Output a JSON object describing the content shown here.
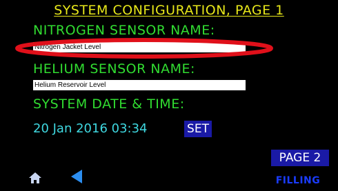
{
  "screen": {
    "title": "SYSTEM CONFIGURATION, PAGE 1",
    "nitrogen": {
      "label": "NITROGEN SENSOR NAME:",
      "value": "Nitrogen Jacket Level"
    },
    "helium": {
      "label": "HELIUM SENSOR NAME:",
      "value": "Helium Reservoir Level"
    },
    "datetime": {
      "label": "SYSTEM DATE & TIME:",
      "value": "20 Jan 2016 03:34",
      "set_label": "SET"
    },
    "page2_label": "PAGE 2",
    "status_text": "FILLING"
  },
  "icons": {
    "home": "home-icon",
    "back": "back-arrow-icon"
  },
  "colors": {
    "background": "#000000",
    "title": "#e8e81a",
    "label": "#31dd31",
    "datetime": "#3fd8e0",
    "button": "#1a1aa6",
    "status": "#1a3cff",
    "highlight": "#e0101a"
  }
}
